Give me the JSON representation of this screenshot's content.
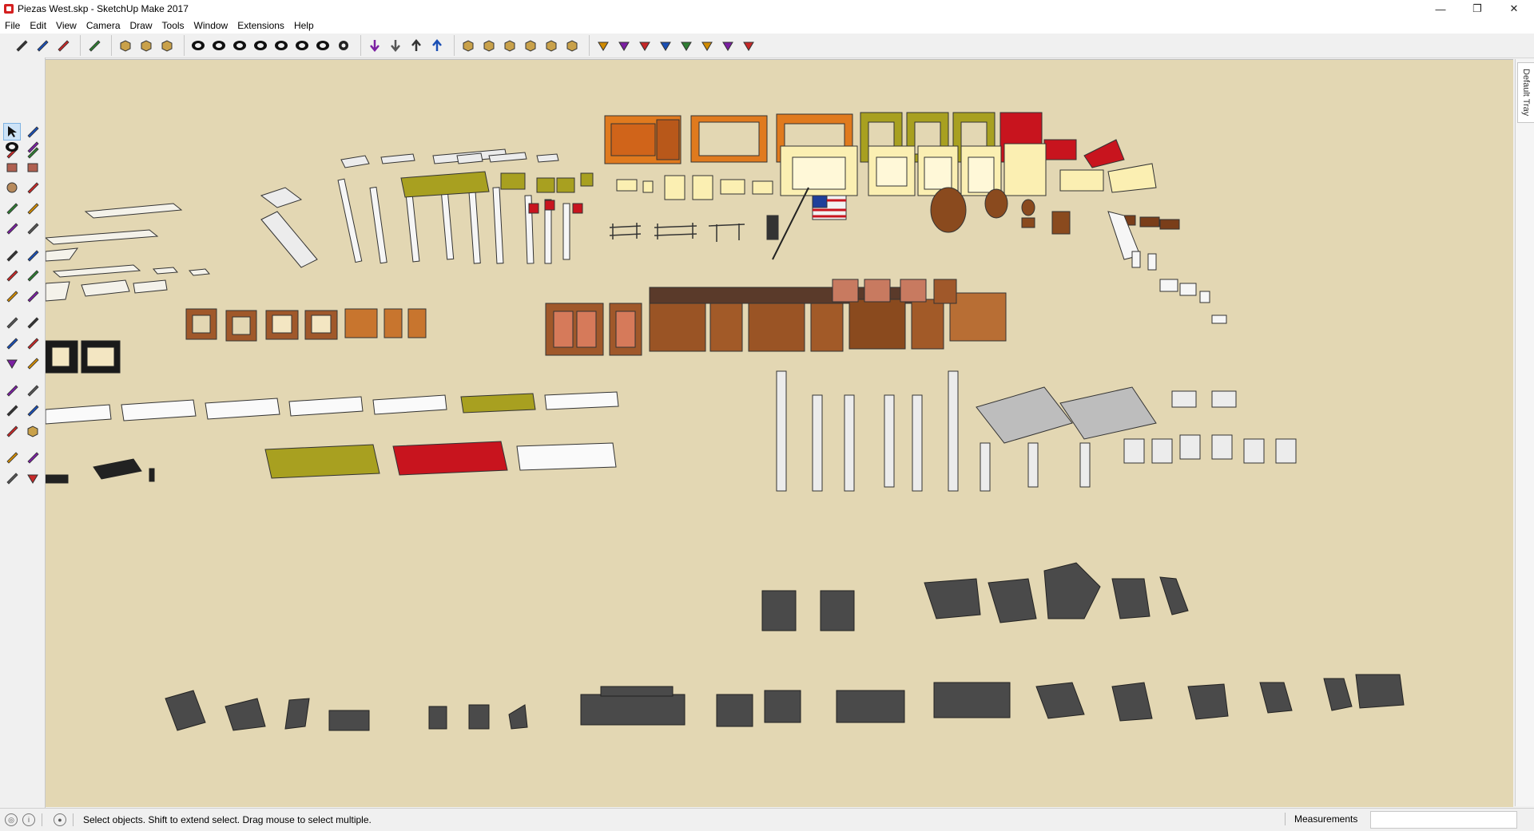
{
  "window": {
    "title": "Piezas West.skp - SketchUp Make 2017",
    "minimize": "—",
    "restore": "❐",
    "close": "✕"
  },
  "menu": [
    "File",
    "Edit",
    "View",
    "Camera",
    "Draw",
    "Tools",
    "Window",
    "Extensions",
    "Help"
  ],
  "toolbar": {
    "groups": [
      [
        "shield-icon",
        "instructor-icon",
        "recycle-icon"
      ],
      [
        "target-icon"
      ],
      [
        "box-open-icon",
        "box-3d-icon",
        "box-model-icon"
      ],
      [
        "xray-icon",
        "backface-icon",
        "wireframe-icon",
        "hidden-line-icon",
        "shaded-icon",
        "shaded-texture-icon",
        "monochrome-icon",
        "settings-gear-icon"
      ],
      [
        "arrow-down-icon",
        "arrow-down-2-icon",
        "arrow-up-icon",
        "arrow-up-top-icon"
      ],
      [
        "iso-view-icon",
        "top-view-icon",
        "front-view-icon",
        "right-view-icon",
        "back-view-icon",
        "left-view-icon"
      ],
      [
        "axes-icon",
        "section-e-icon",
        "section-w-icon",
        "section-r-icon",
        "section-v-icon",
        "section-n-icon",
        "section-o-icon",
        "section-f-icon"
      ]
    ]
  },
  "left_tools": [
    "select-arrow-icon",
    "component-icon",
    "paint-bucket-icon",
    "eraser-icon",
    "pencil-line-icon",
    "freehand-icon",
    "rectangle-icon",
    "rotated-rect-icon",
    "circle-icon",
    "polygon-icon",
    "arc-icon",
    "pie-icon",
    "arc-3pt-icon",
    "arc-2pt-icon",
    "move-icon",
    "push-pull-icon",
    "rotate-icon",
    "follow-me-icon",
    "scale-icon",
    "offset-icon",
    "tape-measure-icon",
    "dimension-icon",
    "protractor-icon",
    "text-icon",
    "axes-tool-icon",
    "3d-text-icon",
    "orbit-icon",
    "pan-icon",
    "zoom-icon",
    "zoom-window-icon",
    "zoom-extents-icon",
    "previous-view-icon",
    "walk-icon",
    "look-around-icon",
    "position-camera-icon",
    "section-plane-icon"
  ],
  "tray": {
    "label": "Default Tray"
  },
  "status": {
    "message": "Select objects. Shift to extend select. Drag mouse to select multiple.",
    "measurements_label": "Measurements",
    "measurements_value": ""
  },
  "colors": {
    "viewport_bg": "#e3d7b3",
    "wood": "#a0582a",
    "orange_wall": "#e07a1e",
    "olive": "#a8a020",
    "red": "#c8141e",
    "cream": "#fbefb2",
    "rock": "#4a4a4a",
    "white": "#ffffff"
  }
}
